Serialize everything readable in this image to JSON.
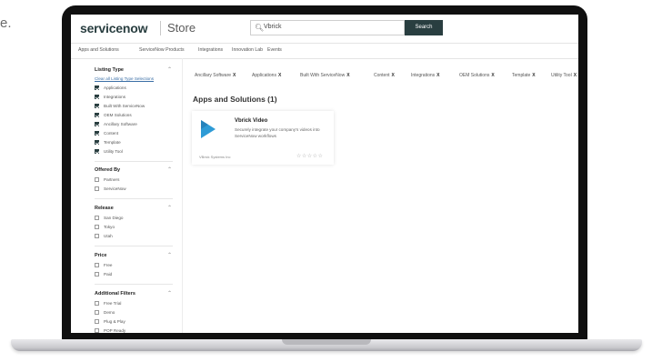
{
  "edge_text": "e.",
  "header": {
    "logo": "servicenow",
    "store_label": "Store",
    "search_value": "Vbrick",
    "search_button": "Search"
  },
  "nav": [
    "Apps and Solutions",
    "ServiceNow Products",
    "Integrations",
    "Innovation Lab",
    "Events"
  ],
  "sidebar": {
    "listing_type": {
      "title": "Listing Type",
      "clear": "Clear all Listing Type Selections",
      "options": [
        {
          "label": "Applications",
          "checked": true
        },
        {
          "label": "Integrations",
          "checked": true
        },
        {
          "label": "Built With ServiceNow",
          "checked": true
        },
        {
          "label": "OEM Solutions",
          "checked": true
        },
        {
          "label": "Ancillary Software",
          "checked": true
        },
        {
          "label": "Content",
          "checked": true
        },
        {
          "label": "Template",
          "checked": true
        },
        {
          "label": "Utility Tool",
          "checked": true
        }
      ]
    },
    "offered_by": {
      "title": "Offered By",
      "options": [
        {
          "label": "Partners",
          "checked": false
        },
        {
          "label": "ServiceNow",
          "checked": false
        }
      ]
    },
    "release": {
      "title": "Release",
      "options": [
        {
          "label": "San Diego",
          "checked": false
        },
        {
          "label": "Tokyo",
          "checked": false
        },
        {
          "label": "Utah",
          "checked": false
        }
      ]
    },
    "price": {
      "title": "Price",
      "options": [
        {
          "label": "Free",
          "checked": false
        },
        {
          "label": "Paid",
          "checked": false
        }
      ]
    },
    "additional": {
      "title": "Additional Filters",
      "options": [
        {
          "label": "Free Trial",
          "checked": false
        },
        {
          "label": "Demo",
          "checked": false
        },
        {
          "label": "Plug & Play",
          "checked": false
        },
        {
          "label": "POP Ready",
          "checked": false
        }
      ]
    }
  },
  "chips": [
    "Ancillary Software",
    "Applications",
    "Built With ServiceNow",
    "Content",
    "Integrations",
    "OEM Solutions",
    "Template",
    "Utility Tool"
  ],
  "chip_close": "X",
  "results_heading": "Apps and Solutions (1)",
  "card": {
    "title": "Vbrick Video",
    "description": "Securely integrate your company's videos into ServiceNow workflows",
    "vendor": "VBrick Systems Inc",
    "stars": "☆☆☆☆☆",
    "icon_color": "#2e9bd6"
  }
}
